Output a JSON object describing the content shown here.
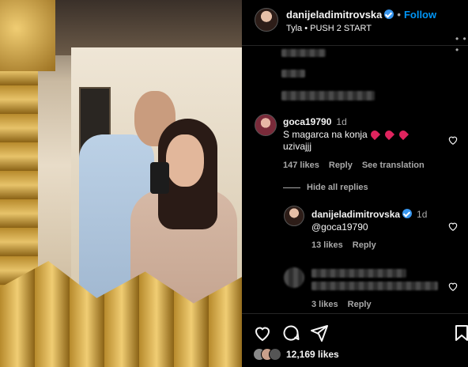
{
  "post": {
    "username": "danijeladimitrovska",
    "follow_label": "Follow",
    "dot": "•",
    "song": "Tyla • PUSH 2 START",
    "more": "• • •"
  },
  "comments": [
    {
      "username": "goca19790",
      "time": "1d",
      "text_line1": "S magarca na konja",
      "text_line2": "uzivajjj",
      "likes": "147 likes",
      "reply": "Reply",
      "translate": "See translation"
    }
  ],
  "hide_replies": "Hide all replies",
  "reply": {
    "username": "danijeladimitrovska",
    "time": "1d",
    "text": "@goca19790",
    "likes": "13 likes",
    "reply": "Reply"
  },
  "third": {
    "likes": "3 likes",
    "reply": "Reply"
  },
  "footer": {
    "likes_count": "12,169 likes"
  },
  "colors": {
    "accent": "#0095f6",
    "verified": "#3897f0",
    "heart_emoji": "#e0245e"
  },
  "icons": [
    "heart-icon",
    "comment-icon",
    "share-icon",
    "bookmark-icon",
    "verified-icon"
  ]
}
